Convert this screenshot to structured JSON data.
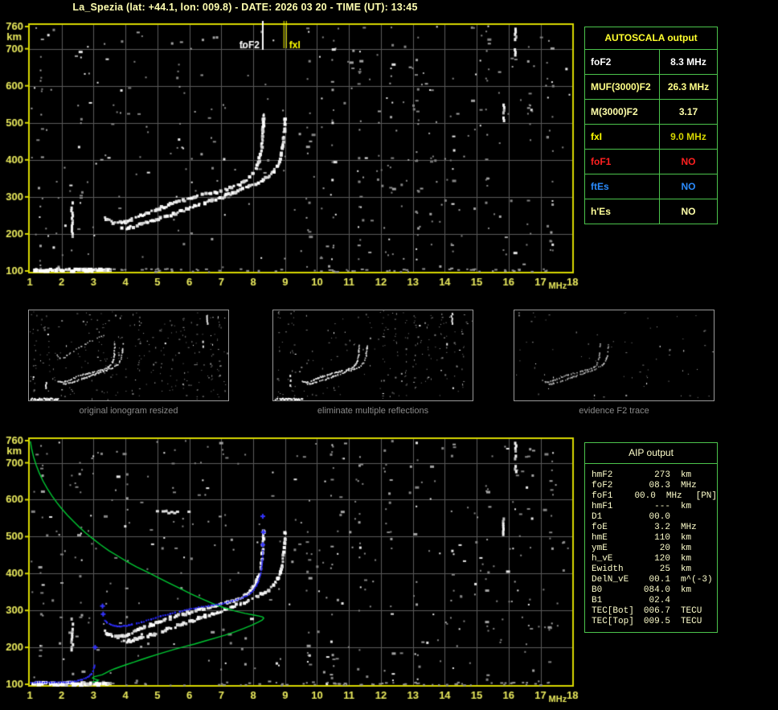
{
  "title": "La_Spezia (lat: +44.1, lon: 009.8) - DATE: 2026 03 20 - TIME (UT): 13:45",
  "autoscala": {
    "header": "AUTOSCALA output",
    "rows": [
      {
        "label": "foF2",
        "value": "8.3 MHz",
        "label_color": "#ffffff",
        "value_color": "#ffffff"
      },
      {
        "label": "MUF(3000)F2",
        "value": "26.3 MHz",
        "label_color": "#ffff88",
        "value_color": "#ffff88"
      },
      {
        "label": "M(3000)F2",
        "value": "3.17",
        "label_color": "#ffffaa",
        "value_color": "#ffffaa"
      },
      {
        "label": "fxI",
        "value": "9.0 MHz",
        "label_color": "#ffff00",
        "value_color": "#d6d600"
      },
      {
        "label": "foF1",
        "value": "NO",
        "label_color": "#ff2020",
        "value_color": "#ff2020"
      },
      {
        "label": "ftEs",
        "value": "NO",
        "label_color": "#2b8cff",
        "value_color": "#2b8cff"
      },
      {
        "label": "h'Es",
        "value": "NO",
        "label_color": "#ffff99",
        "value_color": "#ffffaa"
      }
    ]
  },
  "aip": {
    "header": "AIP output",
    "rows": [
      {
        "label": "hmF2",
        "value": "273",
        "unit": "km",
        "extra": ""
      },
      {
        "label": "foF2",
        "value": "08.3",
        "unit": "MHz",
        "extra": ""
      },
      {
        "label": "foF1",
        "value": "00.0",
        "unit": "MHz",
        "extra": "[PN]"
      },
      {
        "label": "hmF1",
        "value": "---",
        "unit": "km",
        "extra": ""
      },
      {
        "label": "D1",
        "value": "00.0",
        "unit": "",
        "extra": ""
      },
      {
        "label": "foE",
        "value": "3.2",
        "unit": "MHz",
        "extra": ""
      },
      {
        "label": "hmE",
        "value": "110",
        "unit": "km",
        "extra": ""
      },
      {
        "label": "ymE",
        "value": "20",
        "unit": "km",
        "extra": ""
      },
      {
        "label": "h_vE",
        "value": "120",
        "unit": "km",
        "extra": ""
      },
      {
        "label": "Ewidth",
        "value": "25",
        "unit": "km",
        "extra": ""
      },
      {
        "label": "DelN_vE",
        "value": "00.1",
        "unit": "m^(-3)",
        "extra": ""
      },
      {
        "label": "B0",
        "value": "084.0",
        "unit": "km",
        "extra": ""
      },
      {
        "label": "B1",
        "value": "02.4",
        "unit": "",
        "extra": ""
      },
      {
        "label": "TEC[Bot]",
        "value": "006.7",
        "unit": "TECU",
        "extra": ""
      },
      {
        "label": "TEC[Top]",
        "value": "009.5",
        "unit": "TECU",
        "extra": ""
      }
    ]
  },
  "thumbnails": [
    {
      "caption": "original ionogram resized",
      "layers": [
        "noise_heavy",
        "e_echo",
        "streaks",
        "traces",
        "second_hop"
      ]
    },
    {
      "caption": "eliminate multiple reflections",
      "layers": [
        "noise_medium",
        "e_echo",
        "streaks",
        "traces"
      ]
    },
    {
      "caption": "evidence F2 trace",
      "layers": [
        "noise_light",
        "traces_faint"
      ]
    }
  ],
  "chart_data": {
    "type": "scatter",
    "title": "Ionogram with AUTOSCALA interpretation, La_Spezia, 2026-03-20 13:45 UT",
    "x_axis": {
      "label": "MHz",
      "min": 1,
      "max": 18,
      "ticks": [
        1,
        2,
        3,
        4,
        5,
        6,
        7,
        8,
        9,
        10,
        11,
        12,
        13,
        14,
        15,
        16,
        17,
        18
      ]
    },
    "y_axis": {
      "label": "km",
      "min": 100,
      "max": 760,
      "ticks": [
        760,
        700,
        600,
        500,
        400,
        300,
        200,
        100
      ]
    },
    "annotations": {
      "foF2_line": {
        "f": 8.3,
        "label": "foF2",
        "color": "#ffffff"
      },
      "fxI_line": {
        "f": 9.0,
        "label": "fxI",
        "color": "#ffff00"
      }
    },
    "series": {
      "e_echo": {
        "km": 103,
        "f_range": [
          1.05,
          3.42
        ]
      },
      "o_trace": [
        [
          3.35,
          243
        ],
        [
          3.45,
          237
        ],
        [
          3.6,
          231
        ],
        [
          3.75,
          229
        ],
        [
          3.9,
          230
        ],
        [
          4.05,
          234
        ],
        [
          4.2,
          239
        ],
        [
          4.4,
          246
        ],
        [
          4.6,
          253
        ],
        [
          4.8,
          260
        ],
        [
          5.0,
          267
        ],
        [
          5.2,
          273
        ],
        [
          5.4,
          279
        ],
        [
          5.6,
          285
        ],
        [
          5.8,
          290
        ],
        [
          6.0,
          295
        ],
        [
          6.2,
          300
        ],
        [
          6.4,
          304
        ],
        [
          6.6,
          308
        ],
        [
          6.8,
          312
        ],
        [
          7.0,
          316
        ],
        [
          7.2,
          321
        ],
        [
          7.4,
          327
        ],
        [
          7.6,
          334
        ],
        [
          7.75,
          342
        ],
        [
          7.9,
          352
        ],
        [
          8.0,
          363
        ],
        [
          8.1,
          377
        ],
        [
          8.17,
          394
        ],
        [
          8.23,
          414
        ],
        [
          8.27,
          437
        ],
        [
          8.3,
          463
        ],
        [
          8.32,
          492
        ],
        [
          8.33,
          518
        ]
      ],
      "x_trace": [
        [
          3.9,
          214
        ],
        [
          4.1,
          217
        ],
        [
          4.3,
          221
        ],
        [
          4.5,
          226
        ],
        [
          4.7,
          231
        ],
        [
          4.9,
          236
        ],
        [
          5.1,
          242
        ],
        [
          5.3,
          248
        ],
        [
          5.5,
          254
        ],
        [
          5.7,
          260
        ],
        [
          5.9,
          266
        ],
        [
          6.1,
          272
        ],
        [
          6.3,
          278
        ],
        [
          6.5,
          284
        ],
        [
          6.7,
          290
        ],
        [
          6.9,
          296
        ],
        [
          7.1,
          302
        ],
        [
          7.35,
          310
        ],
        [
          7.6,
          318
        ],
        [
          7.85,
          327
        ],
        [
          8.1,
          336
        ],
        [
          8.3,
          345
        ],
        [
          8.5,
          356
        ],
        [
          8.65,
          369
        ],
        [
          8.77,
          385
        ],
        [
          8.86,
          405
        ],
        [
          8.92,
          429
        ],
        [
          8.96,
          456
        ],
        [
          8.99,
          485
        ],
        [
          9.01,
          512
        ]
      ],
      "restored_E_blue": [
        [
          1.05,
          105
        ],
        [
          1.2,
          105
        ],
        [
          1.35,
          105
        ],
        [
          1.5,
          105
        ],
        [
          1.65,
          105
        ],
        [
          1.8,
          105
        ],
        [
          1.95,
          105
        ],
        [
          2.1,
          105
        ],
        [
          2.25,
          106
        ],
        [
          2.4,
          107
        ],
        [
          2.52,
          110
        ],
        [
          2.64,
          113
        ],
        [
          2.76,
          117
        ],
        [
          2.86,
          122
        ],
        [
          2.93,
          128
        ],
        [
          2.98,
          135
        ],
        [
          3.01,
          143
        ],
        [
          3.03,
          152
        ]
      ],
      "restored_F_blue": [
        [
          3.35,
          273
        ],
        [
          3.42,
          267
        ],
        [
          3.5,
          263
        ],
        [
          3.6,
          260
        ],
        [
          3.7,
          258
        ],
        [
          3.8,
          257
        ],
        [
          3.9,
          257
        ],
        [
          4.0,
          258
        ],
        [
          4.1,
          260
        ],
        [
          4.2,
          262
        ],
        [
          4.35,
          265
        ],
        [
          4.5,
          268
        ],
        [
          4.65,
          272
        ],
        [
          4.8,
          276
        ],
        [
          4.95,
          280
        ],
        [
          5.1,
          284
        ],
        [
          5.25,
          287
        ],
        [
          5.4,
          291
        ],
        [
          5.55,
          294
        ],
        [
          5.7,
          297
        ],
        [
          5.85,
          300
        ],
        [
          6.0,
          303
        ],
        [
          6.15,
          305
        ],
        [
          6.3,
          308
        ],
        [
          6.45,
          310
        ],
        [
          6.6,
          312
        ],
        [
          6.75,
          314
        ],
        [
          6.9,
          316
        ],
        [
          7.05,
          319
        ],
        [
          7.2,
          322
        ],
        [
          7.35,
          325
        ],
        [
          7.5,
          329
        ],
        [
          7.65,
          334
        ],
        [
          7.8,
          340
        ],
        [
          7.92,
          347
        ],
        [
          8.02,
          356
        ],
        [
          8.1,
          367
        ],
        [
          8.17,
          380
        ],
        [
          8.22,
          396
        ],
        [
          8.26,
          415
        ],
        [
          8.29,
          437
        ],
        [
          8.31,
          462
        ]
      ],
      "restored_sparse_blue": [
        [
          3.05,
          200
        ],
        [
          3.28,
          312
        ],
        [
          3.3,
          290
        ],
        [
          8.3,
          478
        ],
        [
          8.32,
          512
        ],
        [
          8.3,
          555
        ]
      ],
      "profile_green": [
        [
          1.02,
          758
        ],
        [
          1.06,
          738
        ],
        [
          1.12,
          716
        ],
        [
          1.2,
          694
        ],
        [
          1.3,
          672
        ],
        [
          1.42,
          650
        ],
        [
          1.55,
          630
        ],
        [
          1.7,
          610
        ],
        [
          1.85,
          592
        ],
        [
          2.0,
          576
        ],
        [
          2.18,
          558
        ],
        [
          2.36,
          542
        ],
        [
          2.55,
          526
        ],
        [
          2.75,
          510
        ],
        [
          2.98,
          494
        ],
        [
          3.22,
          478
        ],
        [
          3.48,
          462
        ],
        [
          3.75,
          448
        ],
        [
          4.05,
          432
        ],
        [
          4.35,
          418
        ],
        [
          4.68,
          404
        ],
        [
          5.0,
          390
        ],
        [
          5.35,
          375
        ],
        [
          5.7,
          360
        ],
        [
          6.05,
          345
        ],
        [
          6.4,
          331
        ],
        [
          6.75,
          318
        ],
        [
          7.1,
          307
        ],
        [
          7.45,
          298
        ],
        [
          7.75,
          292
        ],
        [
          8.0,
          288
        ],
        [
          8.18,
          285
        ],
        [
          8.3,
          282
        ],
        [
          8.33,
          279
        ],
        [
          8.28,
          274
        ],
        [
          8.15,
          268
        ],
        [
          7.95,
          260
        ],
        [
          7.7,
          251
        ],
        [
          7.42,
          242
        ],
        [
          7.12,
          233
        ],
        [
          6.8,
          225
        ],
        [
          6.48,
          217
        ],
        [
          6.16,
          209
        ],
        [
          5.85,
          202
        ],
        [
          5.55,
          195
        ],
        [
          5.27,
          188
        ],
        [
          5.0,
          181
        ],
        [
          4.75,
          174
        ],
        [
          4.5,
          167
        ],
        [
          4.27,
          160
        ],
        [
          4.05,
          154
        ],
        [
          3.85,
          148
        ],
        [
          3.66,
          142
        ],
        [
          3.5,
          136
        ],
        [
          3.37,
          130
        ],
        [
          3.27,
          126
        ],
        [
          3.14,
          123
        ],
        [
          3.0,
          120
        ],
        [
          2.97,
          117
        ],
        [
          3.05,
          114
        ],
        [
          3.15,
          111
        ],
        [
          3.08,
          108
        ],
        [
          2.96,
          106
        ]
      ],
      "interference_streaks": [
        {
          "f": 2.33,
          "km": [
            196,
            288
          ]
        },
        {
          "f": 15.85,
          "km": [
            504,
            552
          ]
        },
        {
          "f": 16.22,
          "km": [
            676,
            757
          ]
        }
      ],
      "spread_dashes_bottom": {
        "km": 570,
        "f_range": [
          4.95,
          6.1
        ]
      }
    }
  }
}
